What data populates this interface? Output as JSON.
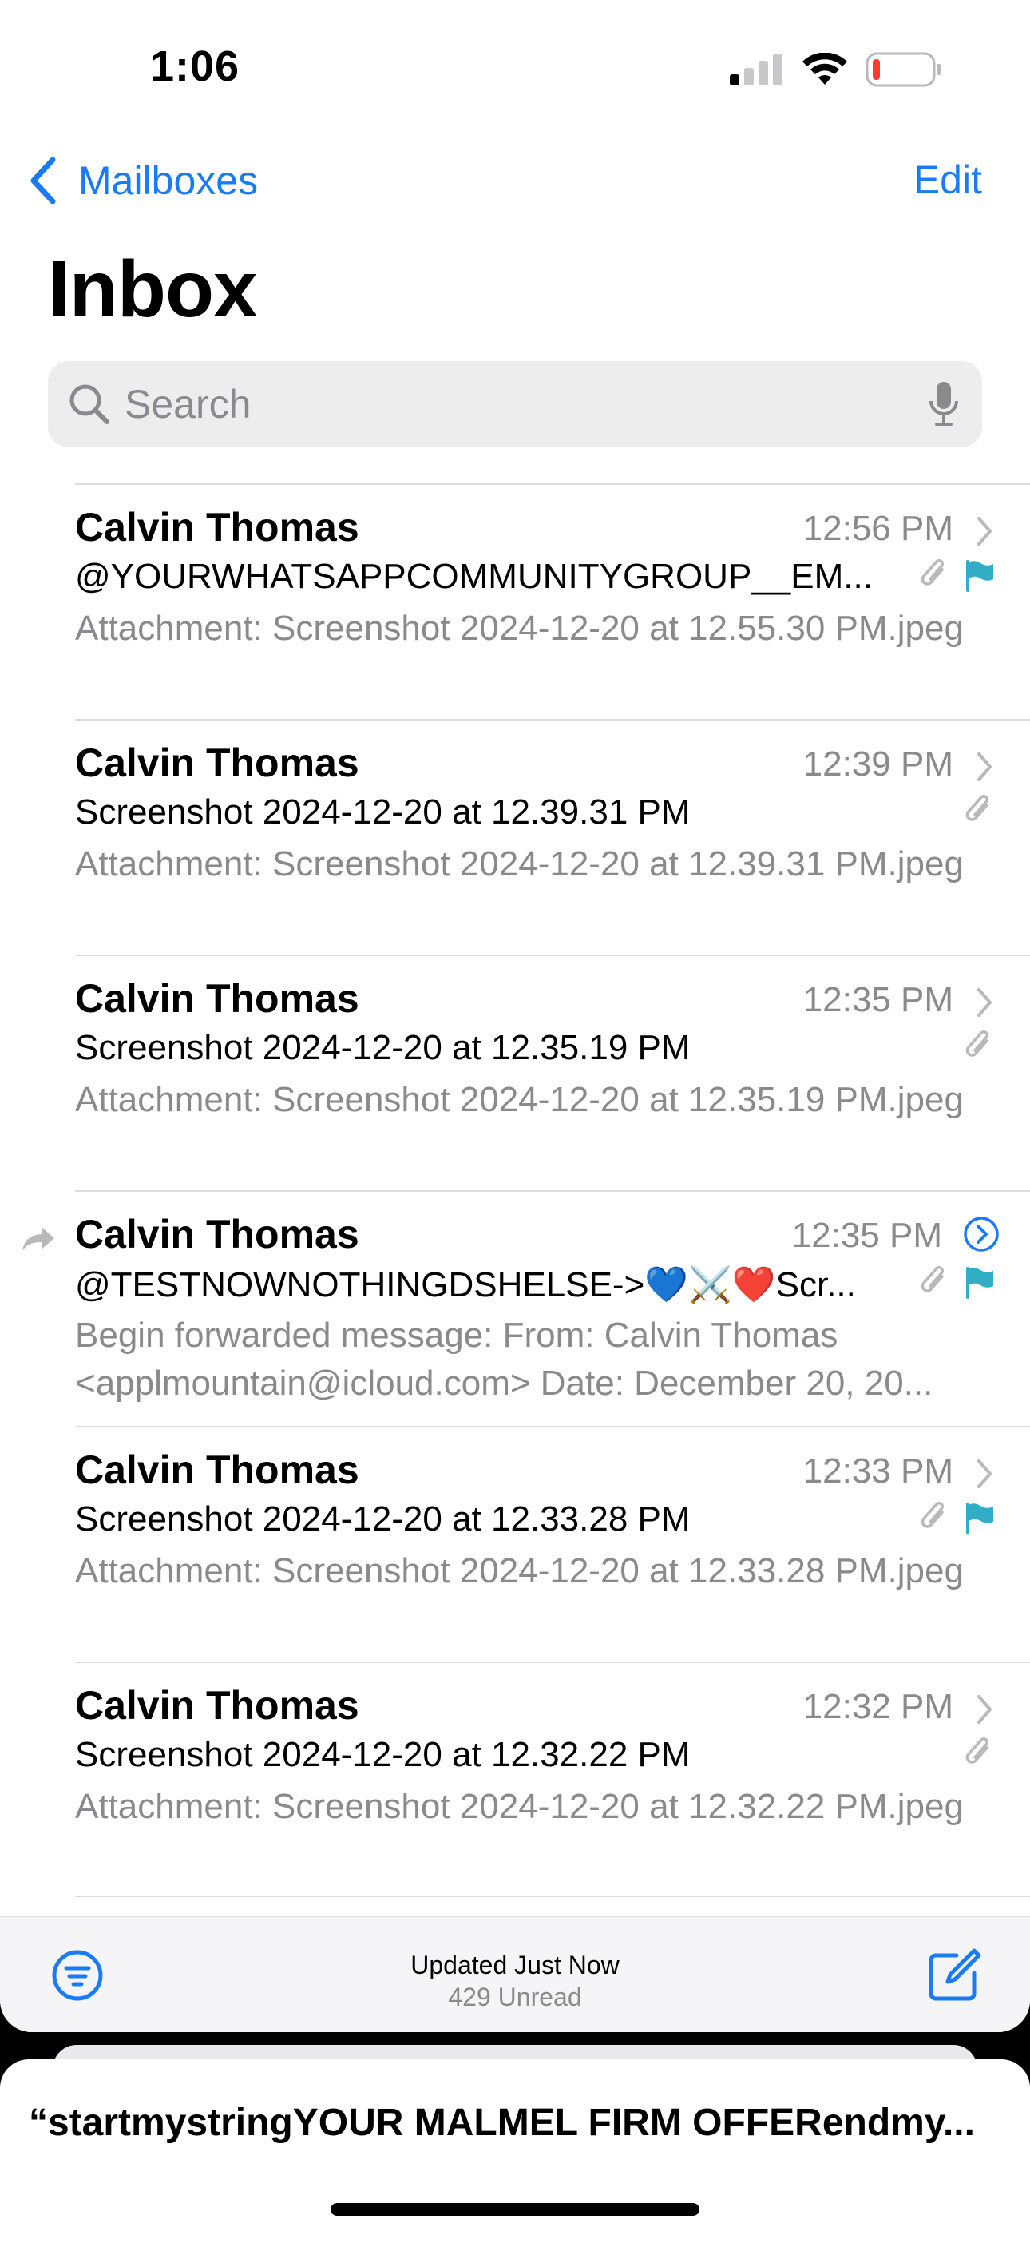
{
  "status_bar": {
    "time": "1:06",
    "icons": [
      "cellular-signal-icon",
      "wifi-icon",
      "battery-low-icon"
    ]
  },
  "nav": {
    "back_label": "Mailboxes",
    "edit_label": "Edit",
    "title": "Inbox"
  },
  "search": {
    "placeholder": "Search",
    "value": ""
  },
  "colors": {
    "accent": "#1a7cf4",
    "flag": "#31adc6",
    "secondary_text": "#8a8a8e"
  },
  "messages": [
    {
      "sender": "Calvin Thomas",
      "time": "12:56 PM",
      "subject": "@YOURWHATSAPPCOMMUNITYGROUP__EM...",
      "preview": "Attachment: Screenshot 2024-12-20 at 12.55.30 PM.jpeg",
      "attachment": true,
      "flagged": true,
      "forwarded": false
    },
    {
      "sender": "Calvin Thomas",
      "time": "12:39 PM",
      "subject": "Screenshot 2024-12-20 at 12.39.31 PM",
      "preview": "Attachment: Screenshot 2024-12-20 at 12.39.31 PM.jpeg",
      "attachment": true,
      "flagged": false,
      "forwarded": false
    },
    {
      "sender": "Calvin Thomas",
      "time": "12:35 PM",
      "subject": "Screenshot 2024-12-20 at 12.35.19 PM",
      "preview": "Attachment: Screenshot 2024-12-20 at 12.35.19 PM.jpeg",
      "attachment": true,
      "flagged": false,
      "forwarded": false
    },
    {
      "sender": "Calvin Thomas",
      "time": "12:35 PM",
      "subject": "@TESTNOWNOTHINGDSHELSE->💙⚔️❤️Scr...",
      "preview": "Begin forwarded message: From: Calvin Thomas <applmountain@icloud.com> Date: December 20, 20...",
      "attachment": true,
      "flagged": true,
      "forwarded": true
    },
    {
      "sender": "Calvin Thomas",
      "time": "12:33 PM",
      "subject": "Screenshot 2024-12-20 at 12.33.28 PM",
      "preview": "Attachment: Screenshot 2024-12-20 at 12.33.28 PM.jpeg",
      "attachment": true,
      "flagged": true,
      "forwarded": false
    },
    {
      "sender": "Calvin Thomas",
      "time": "12:32 PM",
      "subject": "Screenshot 2024-12-20 at 12.32.22 PM",
      "preview": "Attachment: Screenshot 2024-12-20 at 12.32.22 PM.jpeg",
      "attachment": true,
      "flagged": false,
      "forwarded": false
    }
  ],
  "toolbar": {
    "status": "Updated Just Now",
    "unread": "429 Unread"
  },
  "draft": {
    "title": "“startmystringYOUR MALMEL FIRM OFFERendmy..."
  }
}
